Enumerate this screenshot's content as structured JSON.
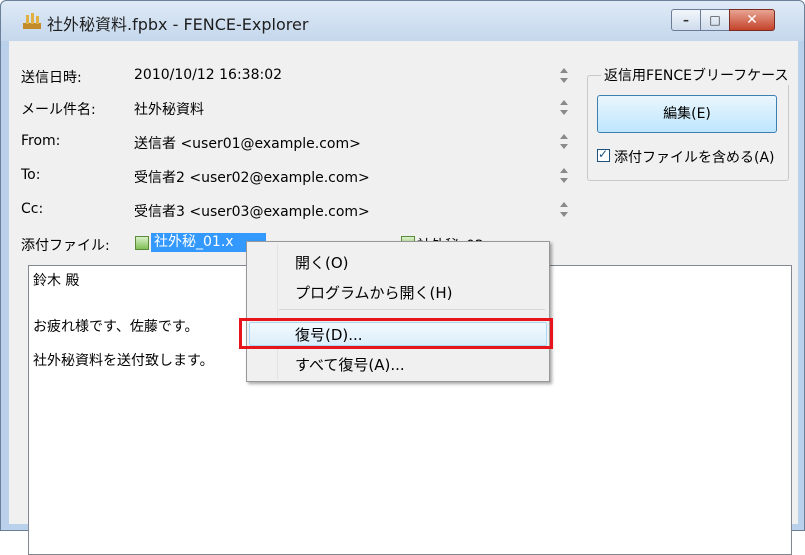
{
  "window": {
    "title": "社外秘資料.fpbx - FENCE-Explorer",
    "controls": {
      "minimize": "–",
      "maximize": "□",
      "close": "✕"
    }
  },
  "header": {
    "date_label": "送信日時:",
    "date_value": "2010/10/12 16:38:02",
    "subject_label": "メール件名:",
    "subject_value": "社外秘資料",
    "from_label": "From:",
    "from_value": "送信者 <user01@example.com>",
    "to_label": "To:",
    "to_value": "受信者2 <user02@example.com>",
    "cc_label": "Cc:",
    "cc_value": "受信者3 <user03@example.com>"
  },
  "reply_group": {
    "title": "返信用FENCEブリーフケース",
    "edit_button": "編集(E)",
    "include_attachments_label": "添付ファイルを含める(A)",
    "include_attachments_checked": true
  },
  "attachments": {
    "label": "添付ファイル:",
    "files": [
      "社外秘_01.x",
      "社外秘_02.x"
    ]
  },
  "body": {
    "lines": [
      "鈴木 殿",
      "お疲れ様です、佐藤です。",
      "社外秘資料を送付致します。"
    ]
  },
  "context_menu": {
    "items": [
      "開く(O)",
      "プログラムから開く(H)",
      "復号(D)...",
      "すべて復号(A)..."
    ],
    "hovered_index": 2,
    "highlight_color": "#e8141b"
  },
  "colors": {
    "selection": "#3399ff",
    "window_frame": "#b9d1ea",
    "close_button": "#c4432b"
  }
}
